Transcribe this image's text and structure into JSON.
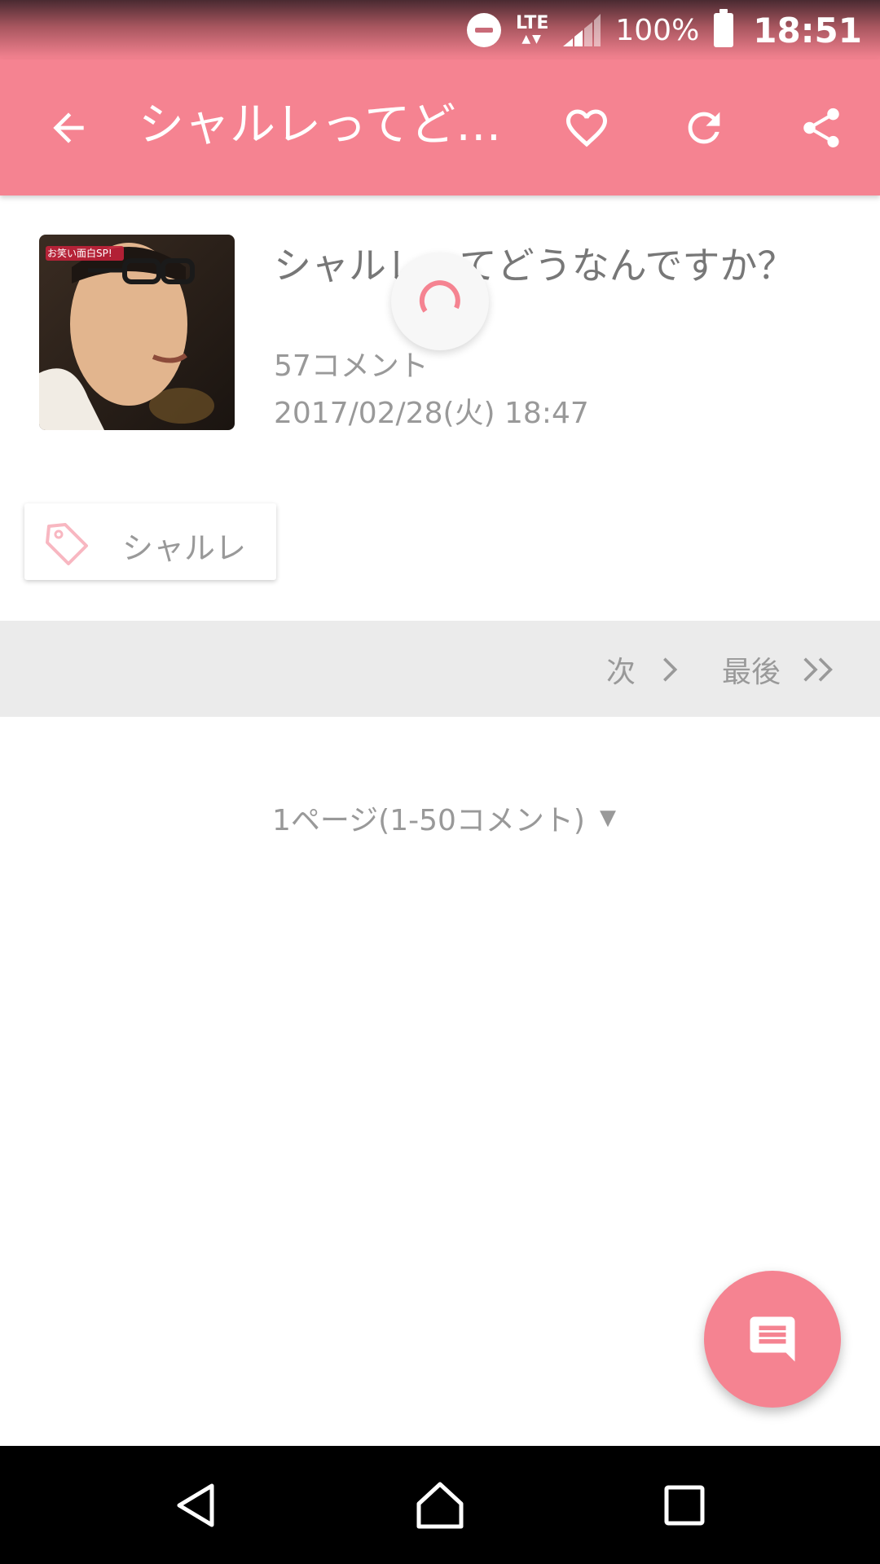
{
  "status": {
    "network": "LTE",
    "network_arrows": "▲▼",
    "battery": "100%",
    "time": "18:51"
  },
  "appbar": {
    "title": "シャルレってど…",
    "icons": [
      "back-arrow-icon",
      "heart-icon",
      "refresh-icon",
      "share-icon"
    ]
  },
  "post": {
    "thumbnail_caption": "お笑い面白SP!",
    "title": "シャルレってどうなんですか？",
    "comment_count": "57コメント",
    "datetime": "2017/02/28(火) 18:47"
  },
  "tags": [
    {
      "label": "シャルレ",
      "icon": "tag-icon"
    }
  ],
  "pager": {
    "next_label": "次",
    "last_label": "最後"
  },
  "page_select": {
    "label": "1ページ(1-50コメント)",
    "arrow": "▼"
  },
  "colors": {
    "accent": "#f58391",
    "pager_bg": "#ebebeb",
    "text_secondary": "#999999"
  }
}
